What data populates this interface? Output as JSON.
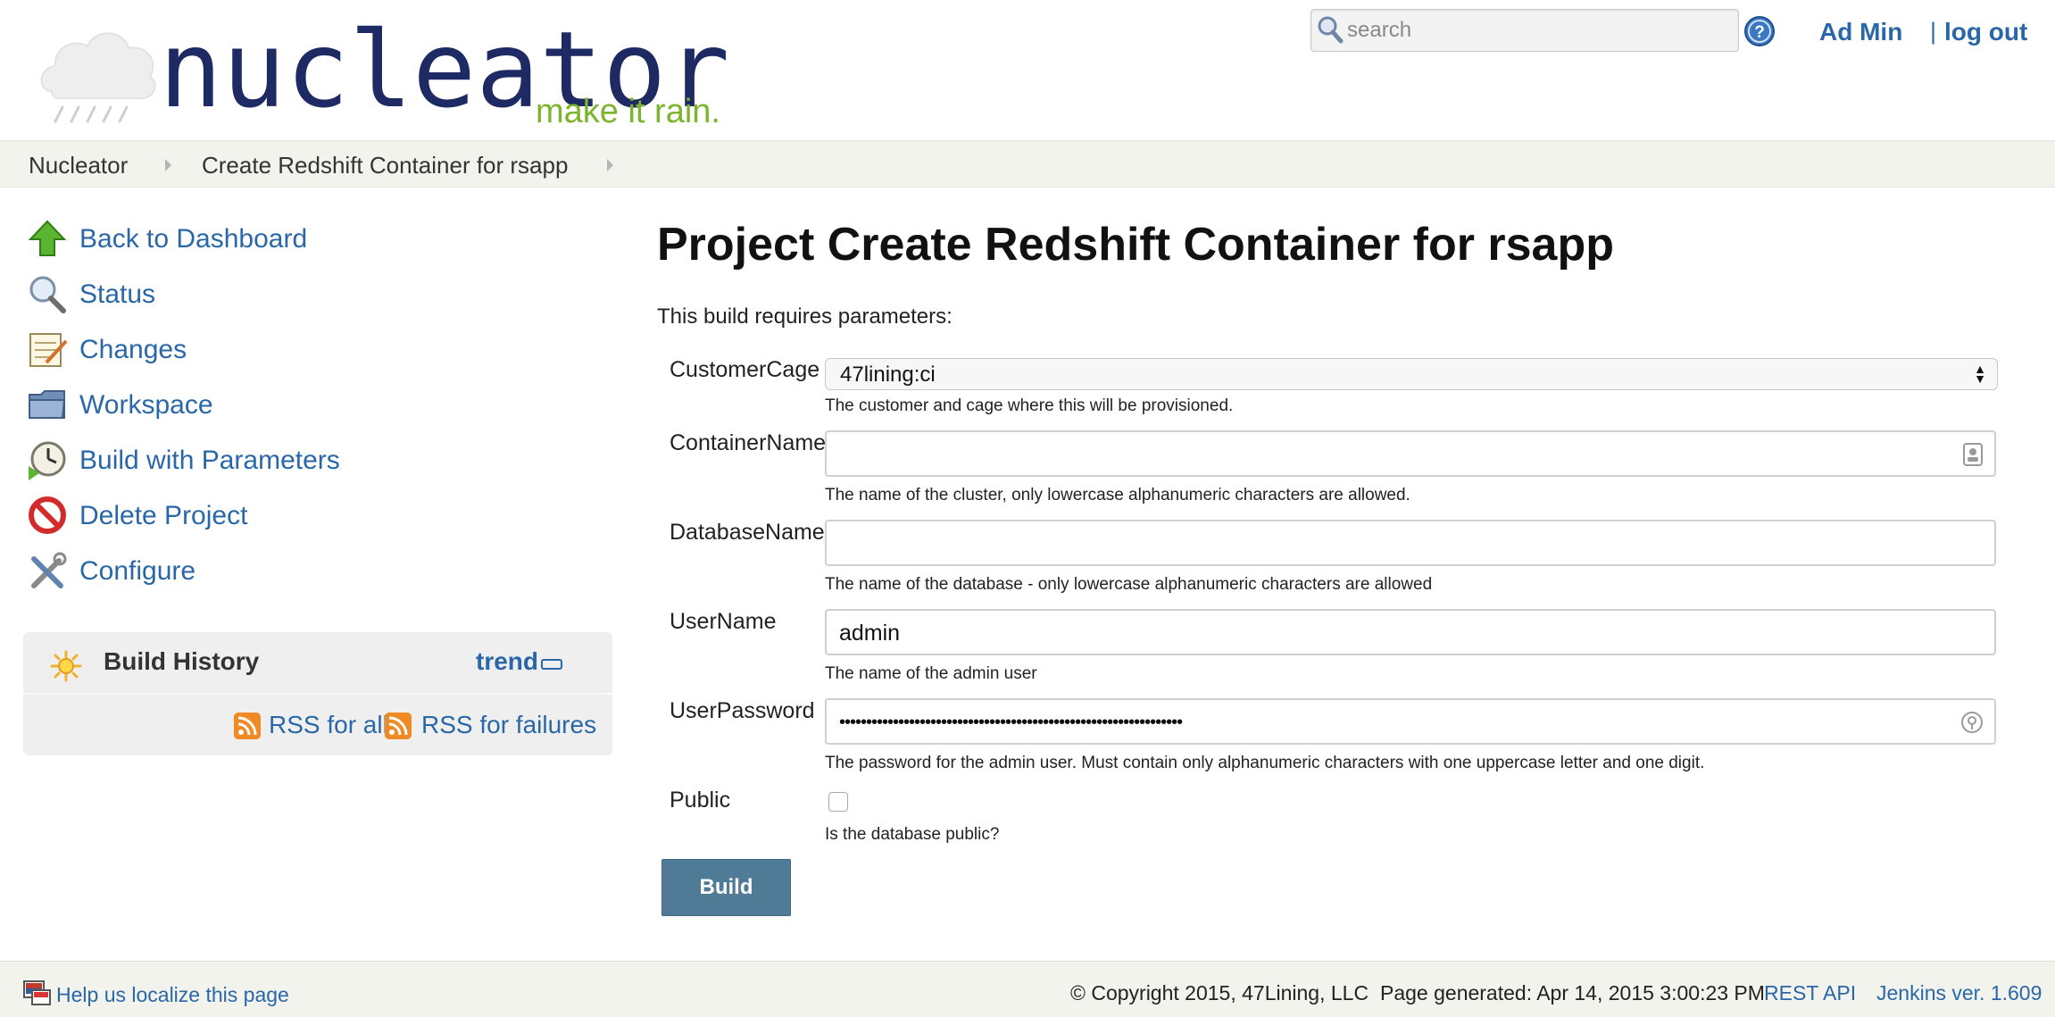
{
  "header": {
    "logo_wordmark": "nucleator",
    "logo_tagline": "make it rain.",
    "search_placeholder": "search",
    "user_name": "Ad Min",
    "logout_separator": "|",
    "logout_label": "log out",
    "icons": {
      "search": "magnifier-icon",
      "help": "question-circle-icon"
    }
  },
  "breadcrumb": {
    "items": [
      "Nucleator",
      "Create Redshift Container for rsapp"
    ]
  },
  "sidebar": {
    "tasks": [
      {
        "label": "Back to Dashboard",
        "icon": "up-arrow-icon"
      },
      {
        "label": "Status",
        "icon": "magnifier-icon"
      },
      {
        "label": "Changes",
        "icon": "notepad-icon"
      },
      {
        "label": "Workspace",
        "icon": "folder-icon"
      },
      {
        "label": "Build with Parameters",
        "icon": "clock-icon"
      },
      {
        "label": "Delete Project",
        "icon": "no-entry-icon"
      },
      {
        "label": "Configure",
        "icon": "tools-icon"
      }
    ],
    "build_history": {
      "title": "Build History",
      "trend_label": "trend",
      "rss_all": "RSS for all",
      "rss_failures": "RSS for failures"
    }
  },
  "main": {
    "title": "Project Create Redshift Container for rsapp",
    "intro": "This build requires parameters:",
    "params": {
      "customer_cage": {
        "label": "CustomerCage",
        "value": "47lining:ci",
        "description": "The customer and cage where this will be provisioned."
      },
      "container_name": {
        "label": "ContainerName",
        "value": "",
        "description": "The name of the cluster, only lowercase alphanumeric characters are allowed."
      },
      "database_name": {
        "label": "DatabaseName",
        "value": "",
        "description": "The name of the database - only lowercase alphanumeric characters are allowed"
      },
      "user_name": {
        "label": "UserName",
        "value": "admin",
        "description": "The name of the admin user"
      },
      "user_password": {
        "label": "UserPassword",
        "value": "••••••••••••••••••••••••••••••••••••••••••••••••••••••••••••••••",
        "description": "The password for the admin user.  Must contain only alphanumeric characters with one uppercase letter and one digit."
      },
      "public": {
        "label": "Public",
        "checked": false,
        "description": "Is the database public?"
      }
    },
    "build_label": "Build"
  },
  "footer": {
    "localize_label": "Help us localize this page",
    "copyright": "© Copyright 2015, 47Lining, LLC",
    "page_generated": "Page generated: Apr 14, 2015 3:00:23 PM",
    "rest_api": "REST API",
    "version": "Jenkins ver. 1.609"
  },
  "colors": {
    "link": "#2a67a8",
    "logo_navy": "#1d2a63",
    "logo_green": "#7db42e",
    "build_button": "#4f7b96",
    "breadcrumb_bg": "#f1f3ec"
  }
}
